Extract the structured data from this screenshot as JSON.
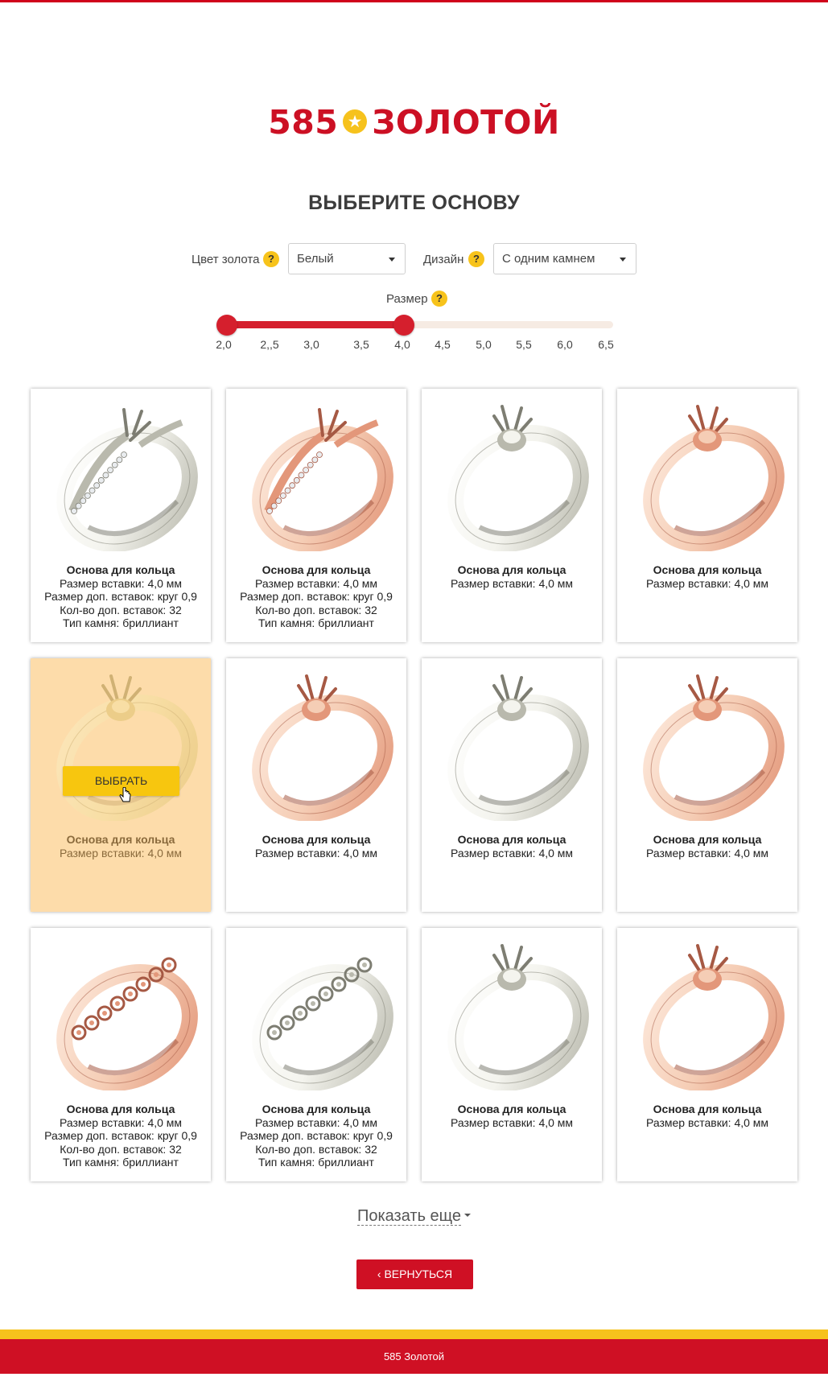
{
  "brand": {
    "number": "585",
    "word": "ЗОЛОТОЙ",
    "color": "#cc1024",
    "star_color": "#f6c21c"
  },
  "page_title": "ВЫБЕРИТЕ ОСНОВУ",
  "filters": {
    "gold_color": {
      "label": "Цвет золота",
      "help": "?",
      "value": "Белый"
    },
    "design": {
      "label": "Дизайн",
      "help": "?",
      "value": "С одним камнем"
    },
    "size": {
      "label": "Размер",
      "help": "?",
      "ticks": [
        "2,0",
        "2,,5",
        "3,0",
        "3,5",
        "4,0",
        "4,5",
        "5,0",
        "5,5",
        "6,0",
        "6,5"
      ],
      "range": [
        "2,0",
        "4,0"
      ]
    }
  },
  "cards": [
    {
      "name": "Основа для кольца",
      "lines": [
        "Размер вставки: 4,0 мм",
        "Размер доп. вставок: круг 0,9",
        "Кол-во доп. вставок: 32",
        "Тип камня: бриллиант"
      ],
      "metal": "white",
      "style": "pave"
    },
    {
      "name": "Основа для кольца",
      "lines": [
        "Размер вставки: 4,0 мм",
        "Размер доп. вставок: круг 0,9",
        "Кол-во доп. вставок: 32",
        "Тип камня: бриллиант"
      ],
      "metal": "rose",
      "style": "pave"
    },
    {
      "name": "Основа для кольца",
      "lines": [
        "Размер вставки: 4,0 мм"
      ],
      "metal": "white",
      "style": "solitaire"
    },
    {
      "name": "Основа для кольца",
      "lines": [
        "Размер вставки: 4,0 мм"
      ],
      "metal": "rose",
      "style": "solitaire"
    },
    {
      "name": "Основа для кольца",
      "lines": [
        "Размер вставки: 4,0 мм"
      ],
      "metal": "yellow",
      "style": "solitaire",
      "hover": true
    },
    {
      "name": "Основа для кольца",
      "lines": [
        "Размер вставки: 4,0 мм"
      ],
      "metal": "rose",
      "style": "solitaire"
    },
    {
      "name": "Основа для кольца",
      "lines": [
        "Размер вставки: 4,0 мм"
      ],
      "metal": "white",
      "style": "solitaire"
    },
    {
      "name": "Основа для кольца",
      "lines": [
        "Размер вставки: 4,0 мм"
      ],
      "metal": "rose",
      "style": "solitaire"
    },
    {
      "name": "Основа для кольца",
      "lines": [
        "Размер вставки: 4,0 мм",
        "Размер доп. вставок: круг 0,9",
        "Кол-во доп. вставок: 32",
        "Тип камня: бриллиант"
      ],
      "metal": "rose",
      "style": "eternity"
    },
    {
      "name": "Основа для кольца",
      "lines": [
        "Размер вставки: 4,0 мм",
        "Размер доп. вставок: круг 0,9",
        "Кол-во доп. вставок: 32",
        "Тип камня: бриллиант"
      ],
      "metal": "white",
      "style": "eternity"
    },
    {
      "name": "Основа для кольца",
      "lines": [
        "Размер вставки: 4,0 мм"
      ],
      "metal": "white",
      "style": "solitaire"
    },
    {
      "name": "Основа для кольца",
      "lines": [
        "Размер вставки: 4,0 мм"
      ],
      "metal": "rose",
      "style": "solitaire"
    }
  ],
  "select_button": "ВЫБРАТЬ",
  "show_more": "Показать еще",
  "back_button": "ВЕРНУТЬСЯ",
  "footer": "585 Золотой",
  "colors": {
    "accent": "#cf1024",
    "yellow": "#f6c21c",
    "hover_bg": "#fddcaa"
  }
}
